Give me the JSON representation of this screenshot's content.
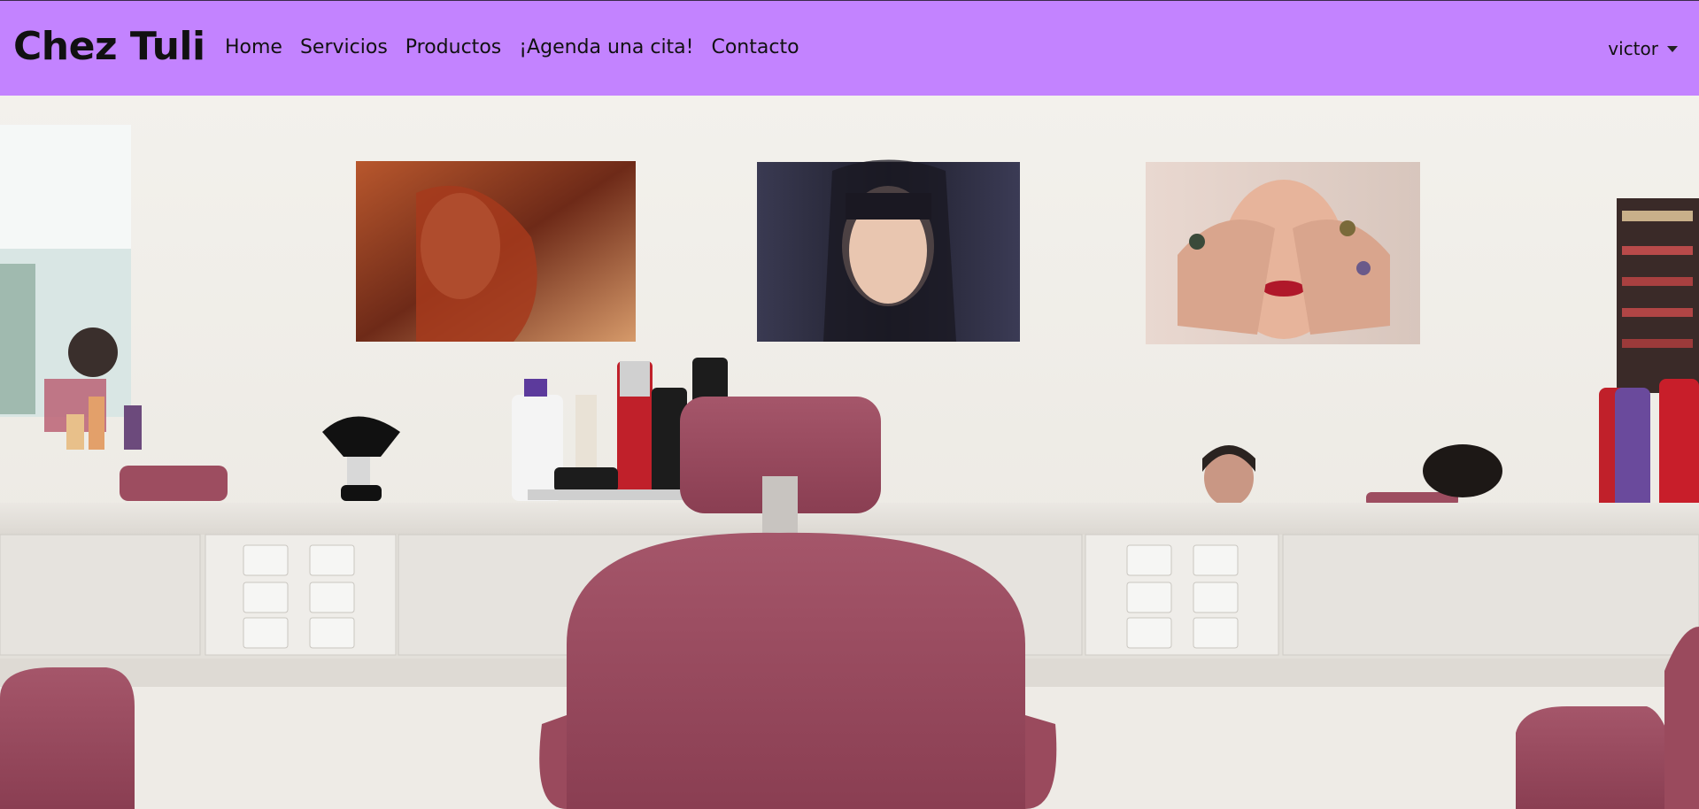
{
  "navbar": {
    "brand": "Chez Tuli",
    "links": [
      "Home",
      "Servicios",
      "Productos",
      "¡Agenda una cita!",
      "Contacto"
    ],
    "user": "victor",
    "background": "#c383ff"
  },
  "hero": {
    "icons": [
      "chevron-down-icon"
    ]
  }
}
